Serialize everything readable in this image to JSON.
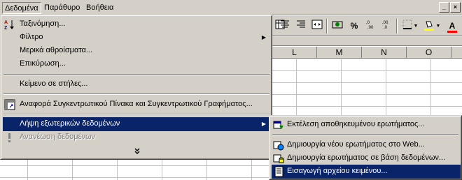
{
  "menubar": {
    "items": [
      {
        "label": "Δεδομένα"
      },
      {
        "label": "Παράθυρο"
      },
      {
        "label": "Βοήθεια"
      }
    ]
  },
  "toolbar": {
    "currency_symbol": "%",
    "font_color_letter": "A"
  },
  "grid": {
    "columns": [
      "L",
      "M",
      "N",
      "O"
    ]
  },
  "data_menu": {
    "items": [
      {
        "label": "Ταξινόμηση...",
        "icon": "sort-az-icon"
      },
      {
        "label": "Φίλτρο",
        "has_submenu": true
      },
      {
        "label": "Μερικά αθροίσματα..."
      },
      {
        "label": "Επικύρωση..."
      },
      {
        "label": "Κείμενο σε στήλες..."
      },
      {
        "label": "Αναφορά Συγκεντρωτικού Πίνακα και Συγκεντρωτικού Γραφήματος...",
        "icon": "pivot-table-icon"
      },
      {
        "label": "Λήψη εξωτερικών δεδομένων",
        "has_submenu": true,
        "highlighted": true
      },
      {
        "label": "Ανανέωση δεδομένων",
        "icon": "refresh-icon",
        "disabled": true
      }
    ]
  },
  "external_data_submenu": {
    "items": [
      {
        "label": "Εκτέλεση αποθηκευμένου ερωτήματος...",
        "icon": "run-query-icon"
      },
      {
        "label": "Δημιουργία νέου ερωτήματος στο Web...",
        "icon": "web-query-icon"
      },
      {
        "label": "Δημιουργία ερωτήματος σε βάση δεδομένων...",
        "icon": "database-query-icon"
      },
      {
        "label": "Εισαγωγή αρχείου κειμένου...",
        "icon": "import-text-icon",
        "highlighted": true
      }
    ]
  }
}
